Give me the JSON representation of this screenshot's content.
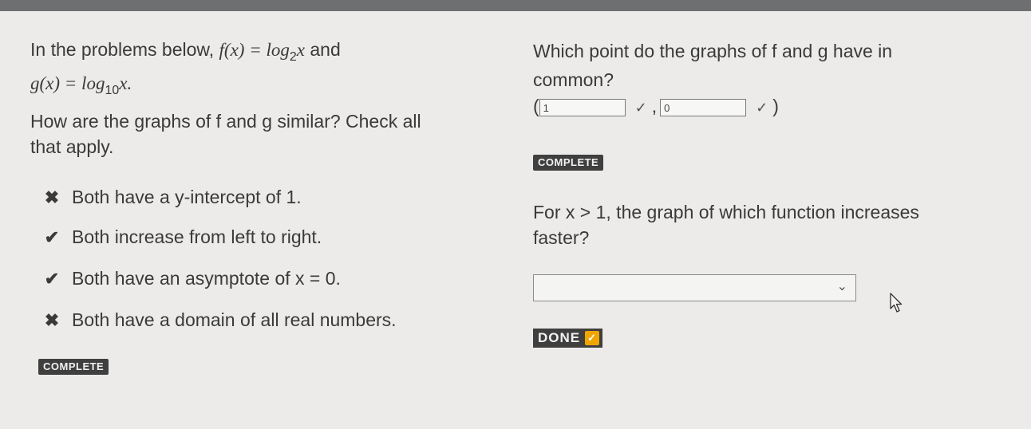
{
  "left": {
    "intro_prefix": "In the problems below, ",
    "f_def": "f(x) = log",
    "f_base": "2",
    "f_arg": "x",
    "intro_and": " and",
    "g_def": "g(x) = log",
    "g_base": "10",
    "g_arg": "x.",
    "question_line1": "How are the graphs of f and g similar? Check all",
    "question_line2": "that apply.",
    "options": [
      {
        "mark": "✖",
        "label": "Both have a y-intercept of 1."
      },
      {
        "mark": "✔",
        "label": "Both increase from left to right."
      },
      {
        "mark": "✔",
        "label": "Both have an asymptote of x = 0."
      },
      {
        "mark": "✖",
        "label": "Both have a domain of all real numbers."
      }
    ],
    "status": "COMPLETE"
  },
  "right": {
    "q1_line1": "Which point do the graphs of f and g have in",
    "q1_line2": "common?",
    "open_paren": "(",
    "x_value": "1",
    "comma": ",",
    "y_value": "0",
    "check_mark": "✓",
    "close_paren": ")",
    "q1_status": "COMPLETE",
    "q2_line1": "For x > 1, the graph of which function increases",
    "q2_line2": "faster?",
    "dropdown_value": "",
    "dropdown_icon": "chevron-down-icon",
    "done_label": "DONE",
    "done_check": "✓"
  },
  "colors": {
    "background": "#ecebe9",
    "badge": "#3f3f3f",
    "done_check": "#f0a500"
  }
}
